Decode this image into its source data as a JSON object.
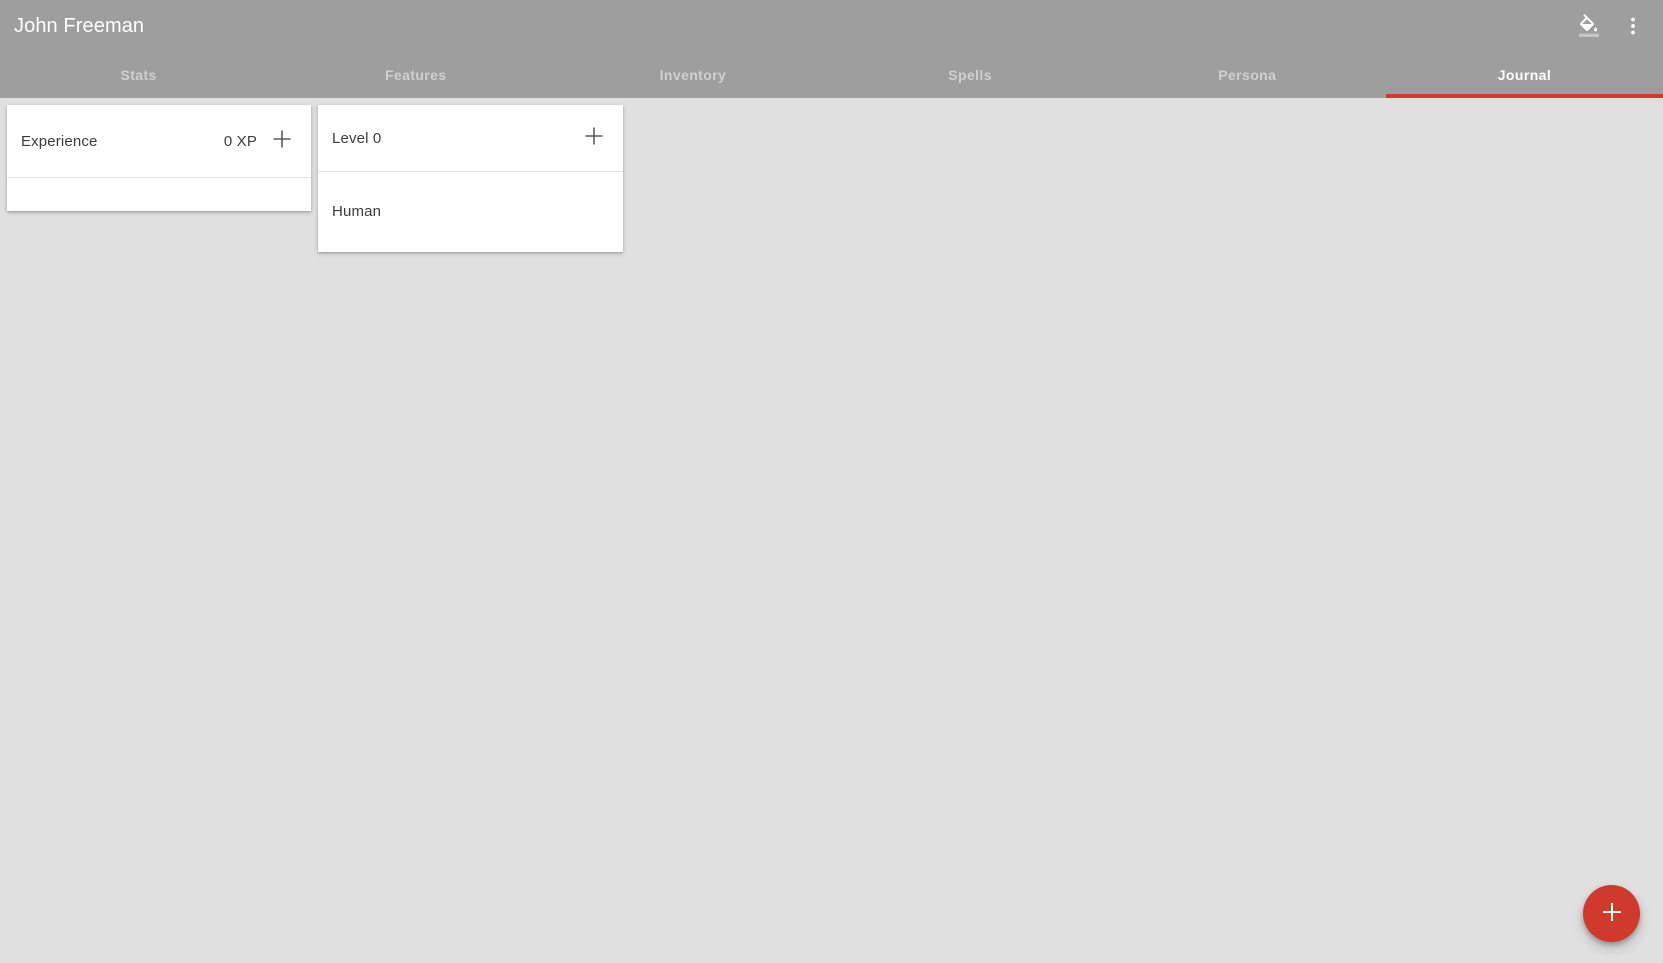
{
  "appbar": {
    "title": "John Freeman",
    "actions": [
      {
        "name": "format-color-fill-icon",
        "label": "Format color fill"
      },
      {
        "name": "more-vert-icon",
        "label": "More options"
      }
    ]
  },
  "tabs": [
    {
      "label": "Stats",
      "active": false
    },
    {
      "label": "Features",
      "active": false
    },
    {
      "label": "Inventory",
      "active": false
    },
    {
      "label": "Spells",
      "active": false
    },
    {
      "label": "Persona",
      "active": false
    },
    {
      "label": "Journal",
      "active": true
    }
  ],
  "cards": {
    "experience": {
      "title": "Experience",
      "value": "0 XP",
      "add_label": "+"
    },
    "level": {
      "title": "Level 0",
      "add_label": "+",
      "race": "Human"
    }
  },
  "fab": {
    "label": "+"
  },
  "colors": {
    "appbar": "#9e9e9e",
    "background": "#e0e0e0",
    "accent": "#d03a2c",
    "card": "#ffffff",
    "text_primary": "#3c3c3c",
    "tab_inactive": "#d0d0d0",
    "tab_active": "#ffffff"
  }
}
